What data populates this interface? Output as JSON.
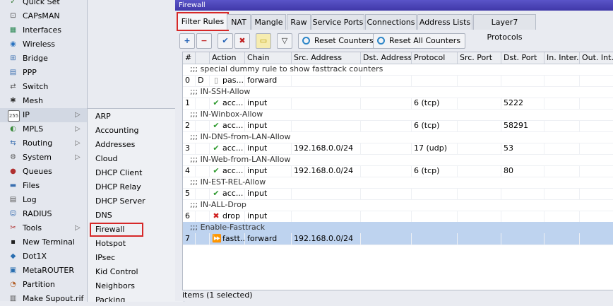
{
  "sidebar": {
    "items": [
      {
        "label": "Quick Set",
        "icon": "quick-set-icon",
        "glyph": "✓",
        "color": "#3a7d3a"
      },
      {
        "label": "CAPsMAN",
        "icon": "capsman-icon",
        "glyph": "⊡",
        "color": "#4b4b4b"
      },
      {
        "label": "Interfaces",
        "icon": "interfaces-icon",
        "glyph": "▦",
        "color": "#2e8b57"
      },
      {
        "label": "Wireless",
        "icon": "wireless-icon",
        "glyph": "◉",
        "color": "#2a73c0"
      },
      {
        "label": "Bridge",
        "icon": "bridge-icon",
        "glyph": "⊞",
        "color": "#3a6fb0"
      },
      {
        "label": "PPP",
        "icon": "ppp-icon",
        "glyph": "▤",
        "color": "#3a6fb0"
      },
      {
        "label": "Switch",
        "icon": "switch-icon",
        "glyph": "⇄",
        "color": "#555555"
      },
      {
        "label": "Mesh",
        "icon": "mesh-icon",
        "glyph": "✱",
        "color": "#333333"
      },
      {
        "label": "IP",
        "icon": "ip-icon",
        "glyph": "255",
        "color": "#444444",
        "arrow": "▷"
      },
      {
        "label": "MPLS",
        "icon": "mpls-icon",
        "glyph": "◐",
        "color": "#3a8a3a",
        "arrow": "▷"
      },
      {
        "label": "Routing",
        "icon": "routing-icon",
        "glyph": "⇆",
        "color": "#3a6fb0",
        "arrow": "▷"
      },
      {
        "label": "System",
        "icon": "system-icon",
        "glyph": "⚙",
        "color": "#555555",
        "arrow": "▷"
      },
      {
        "label": "Queues",
        "icon": "queues-icon",
        "glyph": "●",
        "color": "#b03030"
      },
      {
        "label": "Files",
        "icon": "files-icon",
        "glyph": "▬",
        "color": "#3a6fb0"
      },
      {
        "label": "Log",
        "icon": "log-icon",
        "glyph": "▤",
        "color": "#555555"
      },
      {
        "label": "RADIUS",
        "icon": "radius-icon",
        "glyph": "☺",
        "color": "#3a6fb0"
      },
      {
        "label": "Tools",
        "icon": "tools-icon",
        "glyph": "✂",
        "color": "#b03030",
        "arrow": "▷"
      },
      {
        "label": "New Terminal",
        "icon": "terminal-icon",
        "glyph": "▪",
        "color": "#222222"
      },
      {
        "label": "Dot1X",
        "icon": "dot1x-icon",
        "glyph": "◆",
        "color": "#2a6fb0"
      },
      {
        "label": "MetaROUTER",
        "icon": "metarouter-icon",
        "glyph": "▣",
        "color": "#2a6fb0"
      },
      {
        "label": "Partition",
        "icon": "partition-icon",
        "glyph": "◔",
        "color": "#b05a20"
      },
      {
        "label": "Make Supout.rif",
        "icon": "supout-icon",
        "glyph": "▥",
        "color": "#555555"
      }
    ]
  },
  "submenu": {
    "items": [
      "ARP",
      "Accounting",
      "Addresses",
      "Cloud",
      "DHCP Client",
      "DHCP Relay",
      "DHCP Server",
      "DNS",
      "Firewall",
      "Hotspot",
      "IPsec",
      "Kid Control",
      "Neighbors",
      "Packing"
    ]
  },
  "window": {
    "title": "Firewall",
    "tabs": [
      "Filter Rules",
      "NAT",
      "Mangle",
      "Raw",
      "Service Ports",
      "Connections",
      "Address Lists",
      "Layer7 Protocols"
    ],
    "toolbar": {
      "add": "+",
      "remove": "−",
      "enable": "✔",
      "disable": "✖",
      "comment": "▭",
      "filter": "▽",
      "reset_counters": "Reset Counters",
      "reset_all_counters": "Reset All Counters"
    }
  },
  "table": {
    "columns": [
      "#",
      "Action",
      "Chain",
      "Src. Address",
      "Dst. Address",
      "Protocol",
      "Src. Port",
      "Dst. Port",
      "In. Inter...",
      "Out. Int..."
    ],
    "rows": [
      {
        "type": "comment",
        "text": ";;; special dummy rule to show fasttrack counters"
      },
      {
        "type": "rule",
        "num": "0",
        "flag": "D",
        "action": "pas...",
        "act_icon": "▯",
        "act_color": "#888888",
        "chain": "forward",
        "src": "",
        "dst": "",
        "proto": "",
        "sport": "",
        "dport": ""
      },
      {
        "type": "comment",
        "text": ";;; IN-SSH-Allow"
      },
      {
        "type": "rule",
        "num": "1",
        "flag": "",
        "action": "acc...",
        "act_icon": "✔",
        "act_color": "#2e9a2e",
        "chain": "input",
        "src": "",
        "dst": "",
        "proto": "6 (tcp)",
        "sport": "",
        "dport": "5222"
      },
      {
        "type": "comment",
        "text": ";;; IN-Winbox-Allow"
      },
      {
        "type": "rule",
        "num": "2",
        "flag": "",
        "action": "acc...",
        "act_icon": "✔",
        "act_color": "#2e9a2e",
        "chain": "input",
        "src": "",
        "dst": "",
        "proto": "6 (tcp)",
        "sport": "",
        "dport": "58291"
      },
      {
        "type": "comment",
        "text": ";;; IN-DNS-from-LAN-Allow"
      },
      {
        "type": "rule",
        "num": "3",
        "flag": "",
        "action": "acc...",
        "act_icon": "✔",
        "act_color": "#2e9a2e",
        "chain": "input",
        "src": "192.168.0.0/24",
        "dst": "",
        "proto": "17 (udp)",
        "sport": "",
        "dport": "53"
      },
      {
        "type": "comment",
        "text": ";;; IN-Web-from-LAN-Allow"
      },
      {
        "type": "rule",
        "num": "4",
        "flag": "",
        "action": "acc...",
        "act_icon": "✔",
        "act_color": "#2e9a2e",
        "chain": "input",
        "src": "192.168.0.0/24",
        "dst": "",
        "proto": "6 (tcp)",
        "sport": "",
        "dport": "80"
      },
      {
        "type": "comment",
        "text": ";;; IN-EST-REL-Allow"
      },
      {
        "type": "rule",
        "num": "5",
        "flag": "",
        "action": "acc...",
        "act_icon": "✔",
        "act_color": "#2e9a2e",
        "chain": "input",
        "src": "",
        "dst": "",
        "proto": "",
        "sport": "",
        "dport": ""
      },
      {
        "type": "comment",
        "text": ";;; IN-ALL-Drop"
      },
      {
        "type": "rule",
        "num": "6",
        "flag": "",
        "action": "drop",
        "act_icon": "✖",
        "act_color": "#d02020",
        "chain": "input",
        "src": "",
        "dst": "",
        "proto": "",
        "sport": "",
        "dport": ""
      },
      {
        "type": "comment",
        "text": ";;; Enable-Fasttrack",
        "selected": true
      },
      {
        "type": "rule",
        "num": "7",
        "flag": "",
        "action": "fastt...",
        "act_icon": "⏩",
        "act_color": "#2a6fc0",
        "chain": "forward",
        "src": "192.168.0.0/24",
        "dst": "",
        "proto": "",
        "sport": "",
        "dport": "",
        "selected": true
      }
    ]
  },
  "status": "items (1 selected)",
  "colors": {
    "highlight_box": "#d62828",
    "selection": "#bed3ef",
    "title_bar": "#4a43b8"
  }
}
